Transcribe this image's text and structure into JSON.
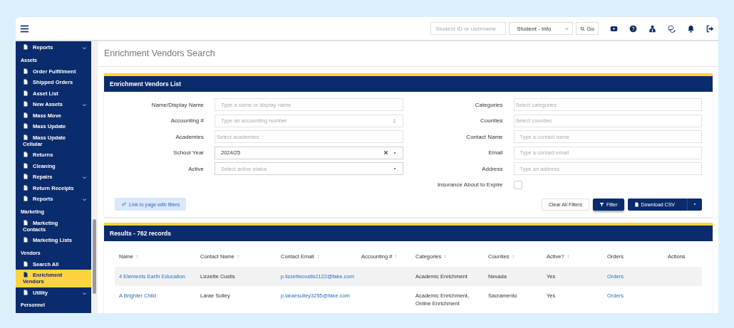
{
  "topbar": {
    "search": {
      "placeholder": "Student ID or username"
    },
    "lookup": {
      "value": "Student - Info"
    },
    "go_button": "Go"
  },
  "sidebar": {
    "items": [
      {
        "kind": "item",
        "label": "Reports",
        "expandable": true,
        "selected": false
      },
      {
        "kind": "header",
        "label": "Assets"
      },
      {
        "kind": "item",
        "label": "Order Fulfillment",
        "expandable": false,
        "selected": false
      },
      {
        "kind": "item",
        "label": "Shipped Orders",
        "expandable": false,
        "selected": false
      },
      {
        "kind": "item",
        "label": "Asset List",
        "expandable": false,
        "selected": false
      },
      {
        "kind": "item",
        "label": "New Assets",
        "expandable": true,
        "selected": false
      },
      {
        "kind": "item",
        "label": "Mass Move",
        "expandable": false,
        "selected": false
      },
      {
        "kind": "item",
        "label": "Mass Update",
        "expandable": false,
        "selected": false
      },
      {
        "kind": "item",
        "label": "Mass Update Cellular",
        "expandable": false,
        "selected": false
      },
      {
        "kind": "item",
        "label": "Returns",
        "expandable": false,
        "selected": false
      },
      {
        "kind": "item",
        "label": "Cleaning",
        "expandable": false,
        "selected": false
      },
      {
        "kind": "item",
        "label": "Repairs",
        "expandable": true,
        "selected": false
      },
      {
        "kind": "item",
        "label": "Return Receipts",
        "expandable": false,
        "selected": false
      },
      {
        "kind": "item",
        "label": "Reports",
        "expandable": true,
        "selected": false
      },
      {
        "kind": "header",
        "label": "Marketing"
      },
      {
        "kind": "item",
        "label": "Marketing Contacts",
        "expandable": false,
        "selected": false
      },
      {
        "kind": "item",
        "label": "Marketing Lists",
        "expandable": false,
        "selected": false
      },
      {
        "kind": "header",
        "label": "Vendors"
      },
      {
        "kind": "item",
        "label": "Search All",
        "expandable": false,
        "selected": false
      },
      {
        "kind": "item",
        "label": "Enrichment Vendors",
        "expandable": false,
        "selected": true
      },
      {
        "kind": "item",
        "label": "Utility",
        "expandable": true,
        "selected": false
      },
      {
        "kind": "header",
        "label": "Personnel"
      }
    ]
  },
  "page_title": "Enrichment Vendors Search",
  "filter_panel": {
    "title": "Enrichment Vendors List",
    "left_fields": [
      {
        "kind": "text",
        "label": "Name/Display Name",
        "placeholder": "Type a name or display name"
      },
      {
        "kind": "number",
        "label": "Accounting #",
        "placeholder": "Type an accounting number"
      },
      {
        "kind": "multiselect",
        "label": "Academies",
        "placeholder": "Select academies"
      },
      {
        "kind": "select",
        "label": "School Year",
        "value": "2024/25",
        "clearable": true
      },
      {
        "kind": "select",
        "label": "Active",
        "placeholder": "Select active status",
        "clearable": false
      }
    ],
    "right_fields": [
      {
        "kind": "multiselect",
        "label": "Categories",
        "placeholder": "Select categories"
      },
      {
        "kind": "multiselect",
        "label": "Counties",
        "placeholder": "Select counties"
      },
      {
        "kind": "text",
        "label": "Contact Name",
        "placeholder": "Type a contact name"
      },
      {
        "kind": "text",
        "label": "Email",
        "placeholder": "Type a contact email"
      },
      {
        "kind": "text",
        "label": "Address",
        "placeholder": "Type an address"
      },
      {
        "kind": "checkbox",
        "label": "Insurance About to Expire",
        "checked": false
      }
    ],
    "link_button": "Link to page with filters",
    "clear_button": "Clear All Filters",
    "filter_button": "Filter",
    "download_button": "Download CSV"
  },
  "results": {
    "title": "Results - 762 records",
    "columns": [
      {
        "label": "Name",
        "sortable": true,
        "kind": "link"
      },
      {
        "label": "Contact Name",
        "sortable": true,
        "kind": "text"
      },
      {
        "label": "Contact Email",
        "sortable": true,
        "kind": "link"
      },
      {
        "label": "Accounting #",
        "sortable": true,
        "kind": "text"
      },
      {
        "label": "Categories",
        "sortable": true,
        "kind": "text"
      },
      {
        "label": "Counties",
        "sortable": true,
        "kind": "text"
      },
      {
        "label": "Active?",
        "sortable": true,
        "kind": "text"
      },
      {
        "label": "Orders",
        "sortable": false,
        "kind": "link"
      },
      {
        "label": "Actions",
        "sortable": false,
        "kind": "text"
      }
    ],
    "rows": [
      [
        "4 Elements Earth Education",
        "Lizzette Custis",
        "p.lizzettecustis1122@fake.com",
        "",
        "Academic Enrichment",
        "Nevada",
        "Yes",
        "Orders",
        ""
      ],
      [
        "A Brighter Child",
        "Larae Sulley",
        "p.laraesulley3255@fake.com",
        "",
        "Academic Enrichment, Online Enrichment",
        "Sacramento",
        "Yes",
        "Orders",
        ""
      ]
    ]
  }
}
